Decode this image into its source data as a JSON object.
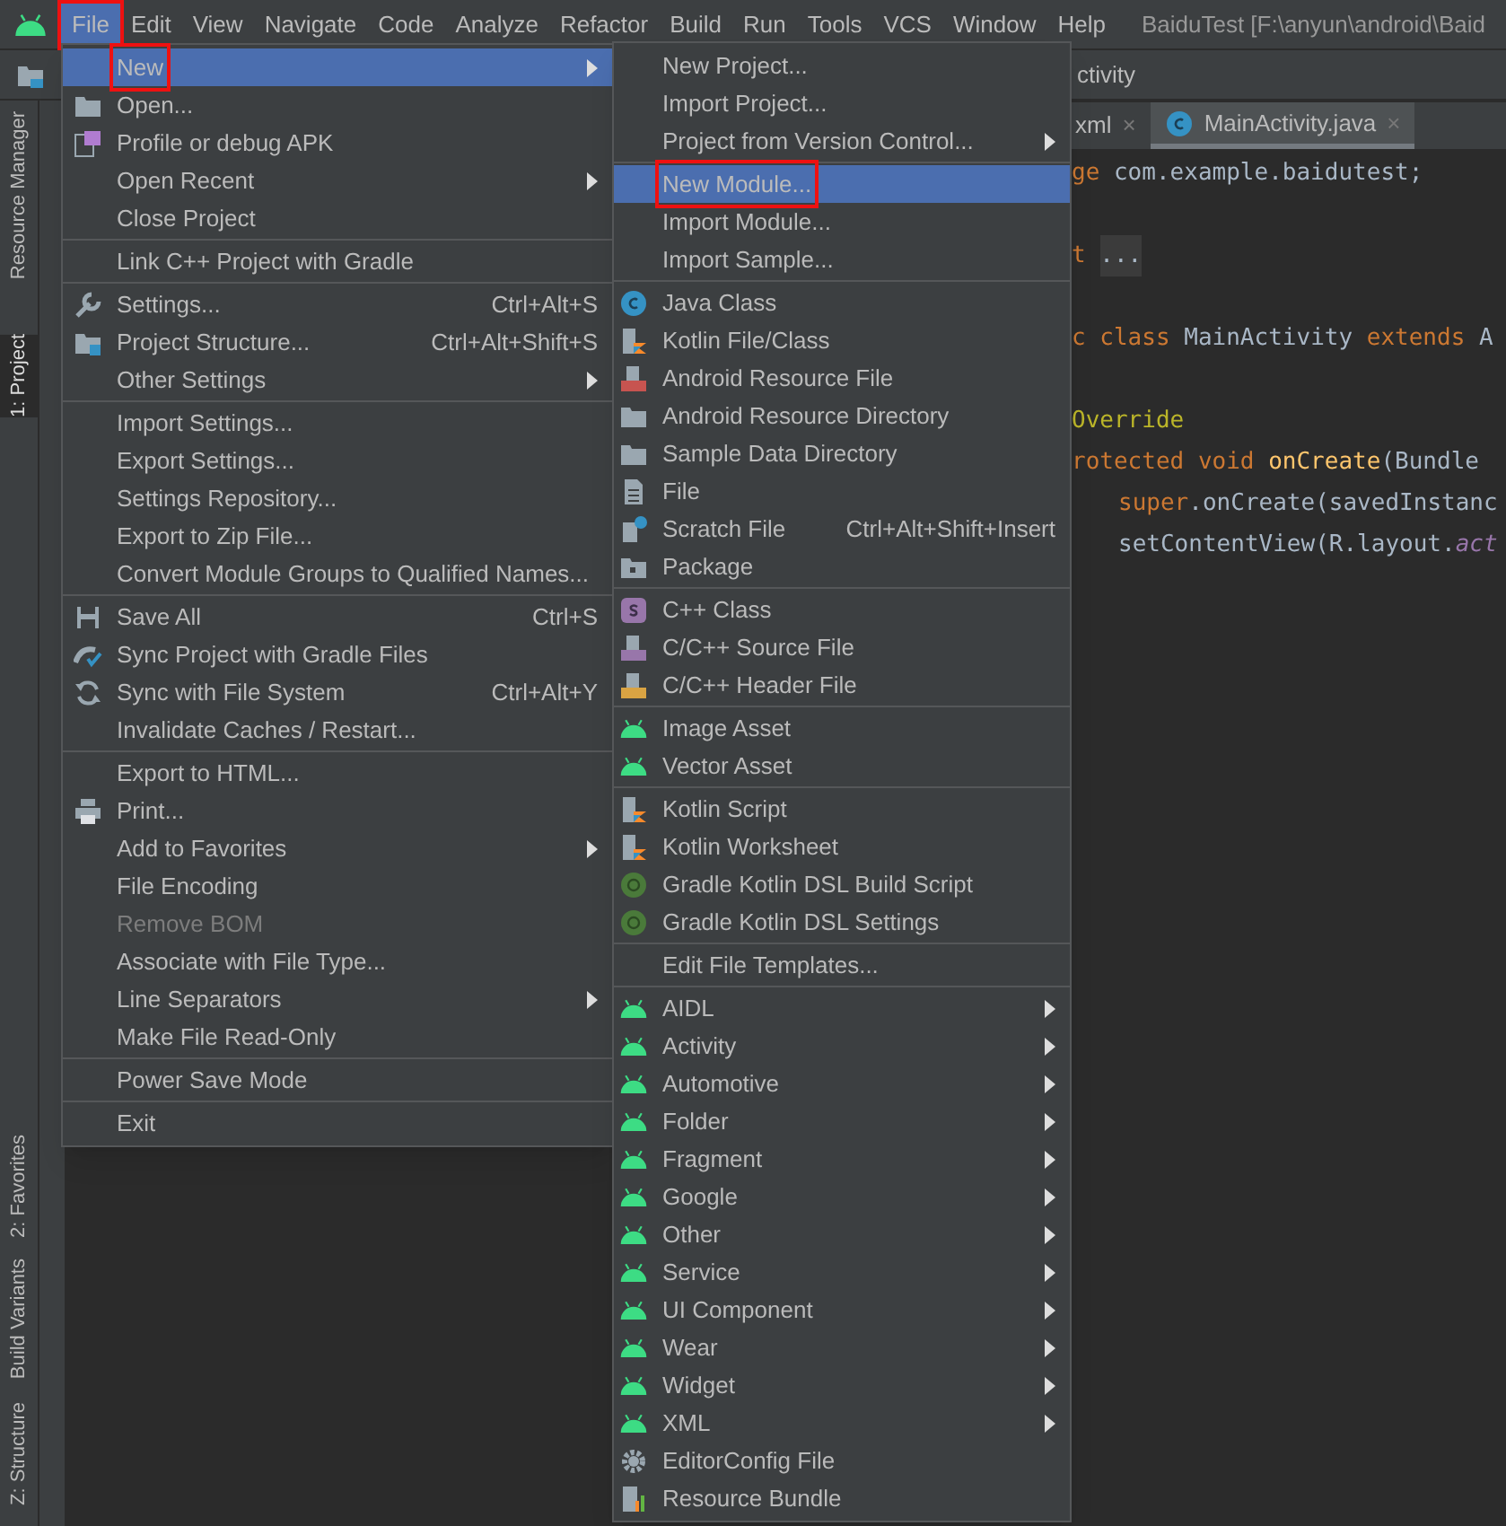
{
  "menu_bar": {
    "items": [
      {
        "label": "File",
        "selected": true,
        "outlined": true
      },
      {
        "label": "Edit",
        "selected": false,
        "outlined": false
      },
      {
        "label": "View",
        "selected": false,
        "outlined": false
      },
      {
        "label": "Navigate",
        "selected": false,
        "outlined": false
      },
      {
        "label": "Code",
        "selected": false,
        "outlined": false
      },
      {
        "label": "Analyze",
        "selected": false,
        "outlined": false
      },
      {
        "label": "Refactor",
        "selected": false,
        "outlined": false
      },
      {
        "label": "Build",
        "selected": false,
        "outlined": false
      },
      {
        "label": "Run",
        "selected": false,
        "outlined": false
      },
      {
        "label": "Tools",
        "selected": false,
        "outlined": false
      },
      {
        "label": "VCS",
        "selected": false,
        "outlined": false
      },
      {
        "label": "Window",
        "selected": false,
        "outlined": false
      },
      {
        "label": "Help",
        "selected": false,
        "outlined": false
      }
    ],
    "window_title": "BaiduTest [F:\\anyun\\android\\Baid"
  },
  "toolbar": {
    "breadcrumb": "ctivity"
  },
  "tool_strip": {
    "top": [
      {
        "label": "Resource Manager",
        "selected": false
      },
      {
        "label": "1: Project",
        "selected": true
      }
    ],
    "bottom": [
      {
        "label": "2: Favorites",
        "selected": false
      },
      {
        "label": "Build Variants",
        "selected": false
      },
      {
        "label": "Z: Structure",
        "selected": false
      }
    ]
  },
  "editor": {
    "tabs": [
      {
        "label": "xml",
        "selected": false,
        "close": "×"
      },
      {
        "label": "MainActivity.java",
        "selected": true,
        "close": "×"
      }
    ],
    "lines": [
      {
        "blank_before": false,
        "indented": false,
        "tokens": [
          {
            "kind": "keyword",
            "text": "ge "
          },
          {
            "kind": "plain",
            "text": "com.example.baidutest;"
          }
        ]
      },
      {
        "blank_before": true,
        "indented": false,
        "tokens": [
          {
            "kind": "keyword",
            "text": "t "
          },
          {
            "kind": "folded",
            "text": "..."
          }
        ]
      },
      {
        "blank_before": true,
        "indented": false,
        "tokens": [
          {
            "kind": "keyword",
            "text": "c class "
          },
          {
            "kind": "plain",
            "text": "MainActivity "
          },
          {
            "kind": "keyword",
            "text": "extends "
          },
          {
            "kind": "plain",
            "text": "A"
          }
        ]
      },
      {
        "blank_before": true,
        "indented": false,
        "tokens": [
          {
            "kind": "annotation",
            "text": "Override"
          }
        ]
      },
      {
        "blank_before": false,
        "indented": false,
        "tokens": [
          {
            "kind": "keyword",
            "text": "rotected void "
          },
          {
            "kind": "method",
            "text": "onCreate"
          },
          {
            "kind": "plain",
            "text": "(Bundle"
          }
        ]
      },
      {
        "blank_before": false,
        "indented": true,
        "tokens": [
          {
            "kind": "keyword",
            "text": "super"
          },
          {
            "kind": "plain",
            "text": ".onCreate(savedInstanc"
          }
        ]
      },
      {
        "blank_before": false,
        "indented": true,
        "tokens": [
          {
            "kind": "plain",
            "text": "setContentView(R.layout."
          },
          {
            "kind": "field",
            "text": "act"
          }
        ]
      }
    ]
  },
  "file_menu": {
    "groups": [
      [
        {
          "label": "New",
          "kind": "plain",
          "submenu": true,
          "selected": true,
          "disabled": false,
          "outlined": true
        },
        {
          "label": "Open...",
          "kind": "folder",
          "submenu": false,
          "selected": false,
          "disabled": false,
          "outlined": false
        },
        {
          "label": "Profile or debug APK",
          "kind": "apk",
          "submenu": false,
          "selected": false,
          "disabled": false,
          "outlined": false
        },
        {
          "label": "Open Recent",
          "kind": "plain",
          "submenu": true,
          "selected": false,
          "disabled": false,
          "outlined": false
        },
        {
          "label": "Close Project",
          "kind": "plain",
          "submenu": false,
          "selected": false,
          "disabled": false,
          "outlined": false
        }
      ],
      [
        {
          "label": "Link C++ Project with Gradle",
          "kind": "plain",
          "submenu": false,
          "selected": false,
          "disabled": false,
          "outlined": false
        }
      ],
      [
        {
          "label": "Settings...",
          "kind": "wrench",
          "shortcut": "Ctrl+Alt+S",
          "submenu": false,
          "selected": false,
          "disabled": false,
          "outlined": false
        },
        {
          "label": "Project Structure...",
          "kind": "structure",
          "shortcut": "Ctrl+Alt+Shift+S",
          "submenu": false,
          "selected": false,
          "disabled": false,
          "outlined": false
        },
        {
          "label": "Other Settings",
          "kind": "plain",
          "submenu": true,
          "selected": false,
          "disabled": false,
          "outlined": false
        }
      ],
      [
        {
          "label": "Import Settings...",
          "kind": "plain",
          "submenu": false,
          "selected": false,
          "disabled": false,
          "outlined": false
        },
        {
          "label": "Export Settings...",
          "kind": "plain",
          "submenu": false,
          "selected": false,
          "disabled": false,
          "outlined": false
        },
        {
          "label": "Settings Repository...",
          "kind": "plain",
          "submenu": false,
          "selected": false,
          "disabled": false,
          "outlined": false
        },
        {
          "label": "Export to Zip File...",
          "kind": "plain",
          "submenu": false,
          "selected": false,
          "disabled": false,
          "outlined": false
        },
        {
          "label": "Convert Module Groups to Qualified Names...",
          "kind": "plain",
          "submenu": false,
          "selected": false,
          "disabled": false,
          "outlined": false
        }
      ],
      [
        {
          "label": "Save All",
          "kind": "save",
          "shortcut": "Ctrl+S",
          "submenu": false,
          "selected": false,
          "disabled": false,
          "outlined": false
        },
        {
          "label": "Sync Project with Gradle Files",
          "kind": "gradlesync",
          "submenu": false,
          "selected": false,
          "disabled": false,
          "outlined": false
        },
        {
          "label": "Sync with File System",
          "kind": "sync",
          "shortcut": "Ctrl+Alt+Y",
          "submenu": false,
          "selected": false,
          "disabled": false,
          "outlined": false
        },
        {
          "label": "Invalidate Caches / Restart...",
          "kind": "plain",
          "submenu": false,
          "selected": false,
          "disabled": false,
          "outlined": false
        }
      ],
      [
        {
          "label": "Export to HTML...",
          "kind": "plain",
          "submenu": false,
          "selected": false,
          "disabled": false,
          "outlined": false
        },
        {
          "label": "Print...",
          "kind": "print",
          "submenu": false,
          "selected": false,
          "disabled": false,
          "outlined": false
        },
        {
          "label": "Add to Favorites",
          "kind": "plain",
          "submenu": true,
          "selected": false,
          "disabled": false,
          "outlined": false
        },
        {
          "label": "File Encoding",
          "kind": "plain",
          "submenu": false,
          "selected": false,
          "disabled": false,
          "outlined": false
        },
        {
          "label": "Remove BOM",
          "kind": "plain",
          "submenu": false,
          "selected": false,
          "disabled": true,
          "outlined": false
        },
        {
          "label": "Associate with File Type...",
          "kind": "plain",
          "submenu": false,
          "selected": false,
          "disabled": false,
          "outlined": false
        },
        {
          "label": "Line Separators",
          "kind": "plain",
          "submenu": true,
          "selected": false,
          "disabled": false,
          "outlined": false
        },
        {
          "label": "Make File Read-Only",
          "kind": "plain",
          "submenu": false,
          "selected": false,
          "disabled": false,
          "outlined": false
        }
      ],
      [
        {
          "label": "Power Save Mode",
          "kind": "plain",
          "submenu": false,
          "selected": false,
          "disabled": false,
          "outlined": false
        }
      ],
      [
        {
          "label": "Exit",
          "kind": "plain",
          "submenu": false,
          "selected": false,
          "disabled": false,
          "outlined": false
        }
      ]
    ]
  },
  "new_submenu": {
    "groups": [
      [
        {
          "label": "New Project...",
          "kind": "plain",
          "submenu": false,
          "selected": false,
          "disabled": false,
          "outlined": false
        },
        {
          "label": "Import Project...",
          "kind": "plain",
          "submenu": false,
          "selected": false,
          "disabled": false,
          "outlined": false
        },
        {
          "label": "Project from Version Control...",
          "kind": "plain",
          "submenu": true,
          "selected": false,
          "disabled": false,
          "outlined": false
        }
      ],
      [
        {
          "label": "New Module...",
          "kind": "plain",
          "submenu": false,
          "selected": true,
          "disabled": false,
          "outlined": true
        },
        {
          "label": "Import Module...",
          "kind": "plain",
          "submenu": false,
          "selected": false,
          "disabled": false,
          "outlined": false
        },
        {
          "label": "Import Sample...",
          "kind": "plain",
          "submenu": false,
          "selected": false,
          "disabled": false,
          "outlined": false
        }
      ],
      [
        {
          "label": "Java Class",
          "kind": "class",
          "submenu": false,
          "selected": false,
          "disabled": false,
          "outlined": false
        },
        {
          "label": "Kotlin File/Class",
          "kind": "kotlin",
          "submenu": false,
          "selected": false,
          "disabled": false,
          "outlined": false
        },
        {
          "label": "Android Resource File",
          "kind": "resfile",
          "submenu": false,
          "selected": false,
          "disabled": false,
          "outlined": false
        },
        {
          "label": "Android Resource Directory",
          "kind": "folder",
          "submenu": false,
          "selected": false,
          "disabled": false,
          "outlined": false
        },
        {
          "label": "Sample Data Directory",
          "kind": "folder",
          "submenu": false,
          "selected": false,
          "disabled": false,
          "outlined": false
        },
        {
          "label": "File",
          "kind": "file",
          "submenu": false,
          "selected": false,
          "disabled": false,
          "outlined": false
        },
        {
          "label": "Scratch File",
          "kind": "scratch",
          "shortcut": "Ctrl+Alt+Shift+Insert",
          "submenu": false,
          "selected": false,
          "disabled": false,
          "outlined": false
        },
        {
          "label": "Package",
          "kind": "package",
          "submenu": false,
          "selected": false,
          "disabled": false,
          "outlined": false
        }
      ],
      [
        {
          "label": "C++ Class",
          "kind": "cppclass",
          "submenu": false,
          "selected": false,
          "disabled": false,
          "outlined": false
        },
        {
          "label": "C/C++ Source File",
          "kind": "cppsource",
          "submenu": false,
          "selected": false,
          "disabled": false,
          "outlined": false
        },
        {
          "label": "C/C++ Header File",
          "kind": "cppheader",
          "submenu": false,
          "selected": false,
          "disabled": false,
          "outlined": false
        }
      ],
      [
        {
          "label": "Image Asset",
          "kind": "android",
          "submenu": false,
          "selected": false,
          "disabled": false,
          "outlined": false
        },
        {
          "label": "Vector Asset",
          "kind": "android",
          "submenu": false,
          "selected": false,
          "disabled": false,
          "outlined": false
        }
      ],
      [
        {
          "label": "Kotlin Script",
          "kind": "kotlin",
          "submenu": false,
          "selected": false,
          "disabled": false,
          "outlined": false
        },
        {
          "label": "Kotlin Worksheet",
          "kind": "kotlin",
          "submenu": false,
          "selected": false,
          "disabled": false,
          "outlined": false
        },
        {
          "label": "Gradle Kotlin DSL Build Script",
          "kind": "gradle",
          "submenu": false,
          "selected": false,
          "disabled": false,
          "outlined": false
        },
        {
          "label": "Gradle Kotlin DSL Settings",
          "kind": "gradle",
          "submenu": false,
          "selected": false,
          "disabled": false,
          "outlined": false
        }
      ],
      [
        {
          "label": "Edit File Templates...",
          "kind": "plain",
          "submenu": false,
          "selected": false,
          "disabled": false,
          "outlined": false
        }
      ],
      [
        {
          "label": "AIDL",
          "kind": "android",
          "submenu": true,
          "selected": false,
          "disabled": false,
          "outlined": false
        },
        {
          "label": "Activity",
          "kind": "android",
          "submenu": true,
          "selected": false,
          "disabled": false,
          "outlined": false
        },
        {
          "label": "Automotive",
          "kind": "android",
          "submenu": true,
          "selected": false,
          "disabled": false,
          "outlined": false
        },
        {
          "label": "Folder",
          "kind": "android",
          "submenu": true,
          "selected": false,
          "disabled": false,
          "outlined": false
        },
        {
          "label": "Fragment",
          "kind": "android",
          "submenu": true,
          "selected": false,
          "disabled": false,
          "outlined": false
        },
        {
          "label": "Google",
          "kind": "android",
          "submenu": true,
          "selected": false,
          "disabled": false,
          "outlined": false
        },
        {
          "label": "Other",
          "kind": "android",
          "submenu": true,
          "selected": false,
          "disabled": false,
          "outlined": false
        },
        {
          "label": "Service",
          "kind": "android",
          "submenu": true,
          "selected": false,
          "disabled": false,
          "outlined": false
        },
        {
          "label": "UI Component",
          "kind": "android",
          "submenu": true,
          "selected": false,
          "disabled": false,
          "outlined": false
        },
        {
          "label": "Wear",
          "kind": "android",
          "submenu": true,
          "selected": false,
          "disabled": false,
          "outlined": false
        },
        {
          "label": "Widget",
          "kind": "android",
          "submenu": true,
          "selected": false,
          "disabled": false,
          "outlined": false
        },
        {
          "label": "XML",
          "kind": "android",
          "submenu": true,
          "selected": false,
          "disabled": false,
          "outlined": false
        },
        {
          "label": "EditorConfig File",
          "kind": "gear",
          "submenu": false,
          "selected": false,
          "disabled": false,
          "outlined": false
        },
        {
          "label": "Resource Bundle",
          "kind": "bundle",
          "submenu": false,
          "selected": false,
          "disabled": false,
          "outlined": false
        }
      ]
    ]
  }
}
